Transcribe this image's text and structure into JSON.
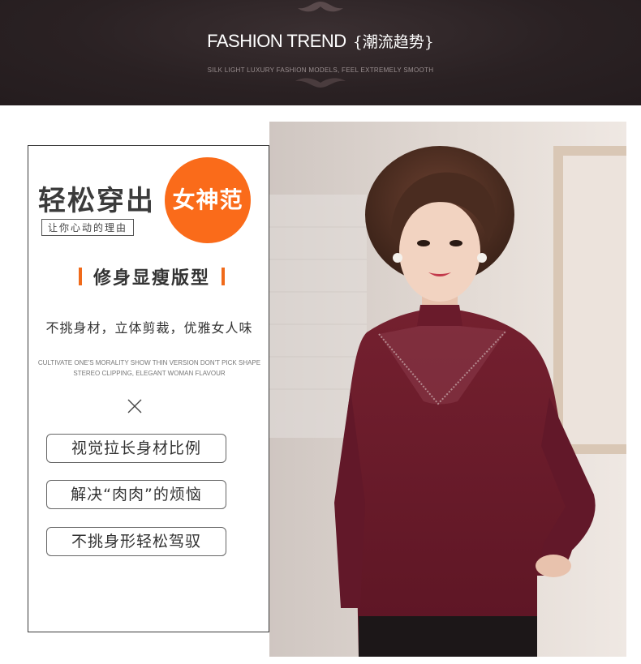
{
  "header": {
    "title_en": "FASHION TREND",
    "title_cn": "{潮流趋势}",
    "subtitle": "SILK LIGHT LUXURY FASHION MODELS, FEEL EXTREMELY SMOOTH"
  },
  "panel": {
    "headline": "轻松穿出",
    "tagline": "让你心动的理由",
    "badge": "女神范",
    "feature_title": "修身显瘦版型",
    "description": "不挑身材，立体剪裁，优雅女人味",
    "description_en_line1": "CULTIVATE ONE'S MORALITY SHOW THIN VERSION DON'T PICK SHAPE",
    "description_en_line2": "STEREO CLIPPING, ELEGANT WOMAN FLAVOUR",
    "pills": [
      "视觉拉长身材比例",
      "解决“肉肉”的烦恼",
      "不挑身形轻松驾驭"
    ]
  },
  "colors": {
    "header_bg": "#2a2123",
    "accent_orange": "#fa6b1a",
    "garment": "#6b1a2c"
  }
}
